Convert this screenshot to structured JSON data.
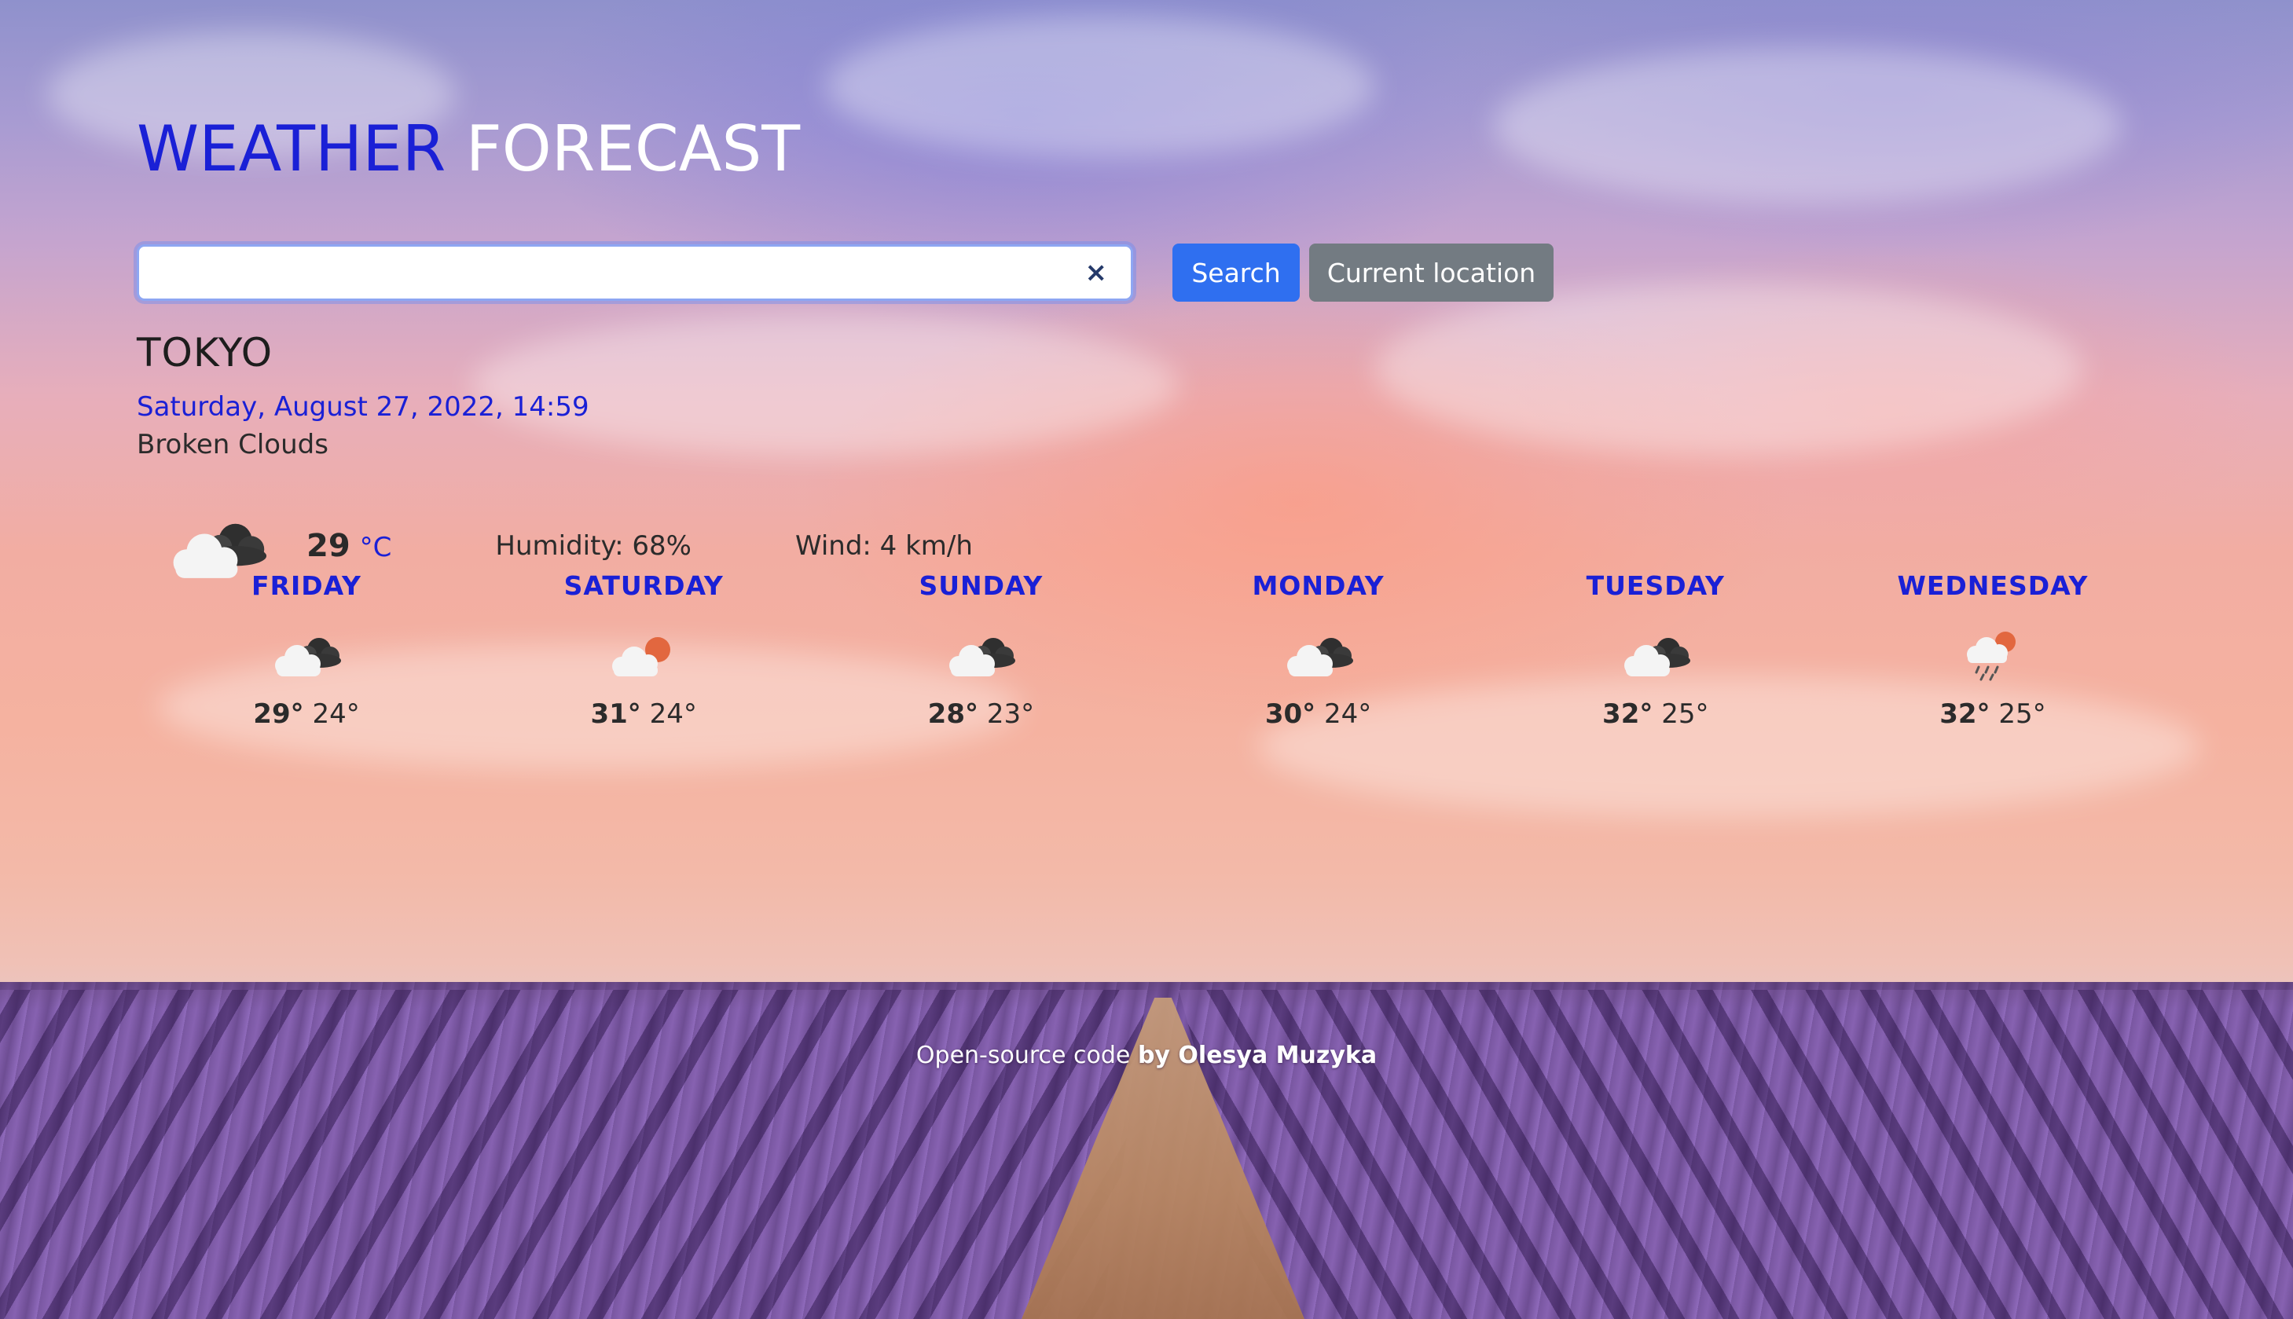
{
  "app": {
    "title_part1": "WEATHER",
    "title_part2": "FORECAST"
  },
  "search": {
    "value": "",
    "placeholder": "",
    "clear_icon": "×",
    "search_label": "Search",
    "location_label": "Current location"
  },
  "current": {
    "city": "TOKYO",
    "datetime": "Saturday, August 27, 2022, 14:59",
    "description": "Broken Clouds",
    "icon": "broken-clouds-icon",
    "temperature": "29",
    "unit": "°C",
    "humidity": "Humidity: 68%",
    "wind": "Wind: 4 km/h"
  },
  "forecast": [
    {
      "day": "FRIDAY",
      "icon": "broken-clouds-icon",
      "high": "29°",
      "low": "24°"
    },
    {
      "day": "SATURDAY",
      "icon": "few-clouds-icon",
      "high": "31°",
      "low": "24°"
    },
    {
      "day": "SUNDAY",
      "icon": "broken-clouds-icon",
      "high": "28°",
      "low": "23°"
    },
    {
      "day": "MONDAY",
      "icon": "broken-clouds-icon",
      "high": "30°",
      "low": "24°"
    },
    {
      "day": "TUESDAY",
      "icon": "broken-clouds-icon",
      "high": "32°",
      "low": "25°"
    },
    {
      "day": "WEDNESDAY",
      "icon": "rain-icon",
      "high": "32°",
      "low": "25°"
    }
  ],
  "footer": {
    "link_text": "Open-source code",
    "author": "by Olesya Muzyka"
  },
  "colors": {
    "accent": "#1a20d6",
    "search_button": "#2f6ff0",
    "location_button": "#737b82"
  }
}
